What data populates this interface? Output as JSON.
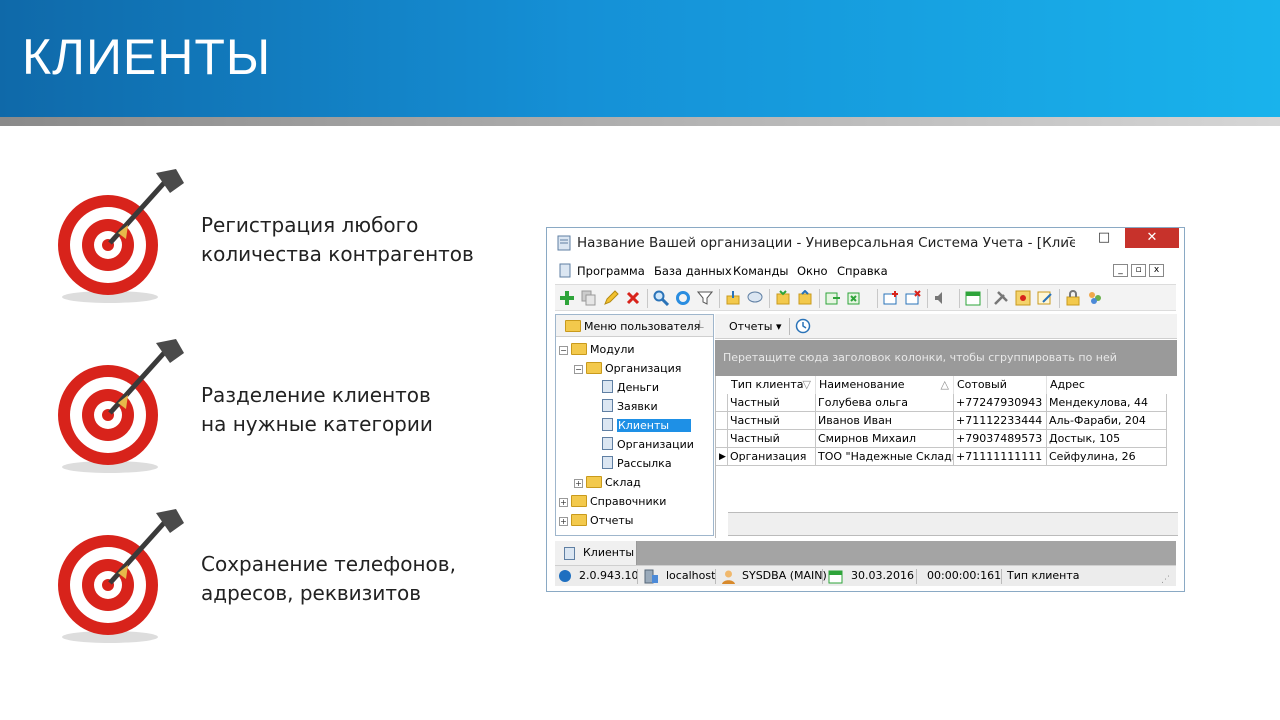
{
  "slide": {
    "title": "КЛИЕНТЫ",
    "bullets": [
      {
        "line1": "Регистрация любого",
        "line2": "количества контрагентов"
      },
      {
        "line1": "Разделение клиентов",
        "line2": "на нужные категории"
      },
      {
        "line1": "Сохранение телефонов,",
        "line2": "адресов, реквизитов"
      }
    ]
  },
  "window": {
    "title": "Название Вашей организации - Универсальная Система Учета - [Клиенты]",
    "controls": {
      "minimize": "–",
      "maximize": "□",
      "close": "✕"
    },
    "menu": [
      "Программа",
      "База данных",
      "Команды",
      "Окно",
      "Справка"
    ],
    "toolbar_icons": [
      "add-icon",
      "copy-icon",
      "edit-icon",
      "delete-icon",
      "search-icon",
      "refresh-icon",
      "filter-icon",
      "export-icon",
      "comment-icon",
      "sort-up-icon",
      "sort-down-icon",
      "import-icon",
      "export-excel-icon",
      "new-window-icon",
      "close-window-icon",
      "sound-icon",
      "calendar-icon",
      "tools-icon",
      "map-icon",
      "notes-icon",
      "lock-icon",
      "users-icon"
    ],
    "left_panel": {
      "title": "Меню пользователя",
      "tree": [
        {
          "label": "Модули",
          "level": 0,
          "type": "folder",
          "expander": "−"
        },
        {
          "label": "Организация",
          "level": 1,
          "type": "folder",
          "expander": "−"
        },
        {
          "label": "Деньги",
          "level": 2,
          "type": "doc"
        },
        {
          "label": "Заявки",
          "level": 2,
          "type": "doc"
        },
        {
          "label": "Клиенты",
          "level": 2,
          "type": "doc",
          "selected": true
        },
        {
          "label": "Организации",
          "level": 2,
          "type": "doc"
        },
        {
          "label": "Рассылка",
          "level": 2,
          "type": "doc"
        },
        {
          "label": "Склад",
          "level": 1,
          "type": "folder",
          "expander": "+"
        },
        {
          "label": "Справочники",
          "level": 0,
          "type": "folder",
          "expander": "+"
        },
        {
          "label": "Отчеты",
          "level": 0,
          "type": "folder",
          "expander": "+"
        }
      ]
    },
    "reports_button": "Отчеты",
    "group_hint": "Перетащите сюда заголовок колонки, чтобы сгруппировать по ней",
    "grid": {
      "columns": [
        "Тип клиента",
        "Наименование",
        "Сотовый",
        "Адрес"
      ],
      "rows": [
        [
          "Частный",
          "Голубева ольга",
          "+77247930943",
          "Мендекулова, 44"
        ],
        [
          "Частный",
          "Иванов Иван",
          "+71112233444",
          "Аль-Фараби, 204"
        ],
        [
          "Частный",
          "Смирнов Михаил",
          "+79037489573",
          "Достык, 105"
        ],
        [
          "Организация",
          "ТОО \"Надежные Склады\"",
          "+71111111111",
          "Сейфулина, 26"
        ]
      ],
      "current_row": 3
    },
    "tab": "Клиенты",
    "status": {
      "version": "2.0.943.10",
      "host": "localhost",
      "user": "SYSDBA (MAIN)",
      "date": "30.03.2016",
      "time": "00:00:00:161",
      "field": "Тип клиента"
    }
  },
  "colors": {
    "header_start": "#0f69a9",
    "header_end": "#19b3ec",
    "close_button": "#c7322b",
    "selection": "#1e90e6",
    "target_red": "#d8231b"
  }
}
